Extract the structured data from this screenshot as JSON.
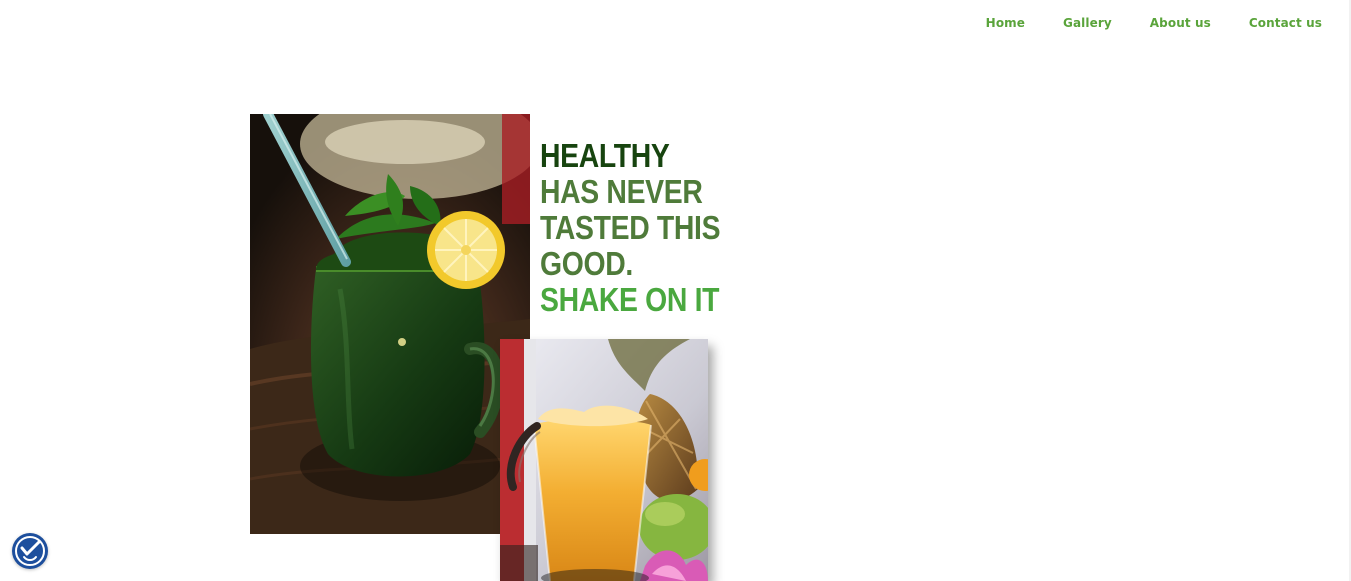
{
  "nav": {
    "items": [
      {
        "label": "Home"
      },
      {
        "label": "Gallery"
      },
      {
        "label": "About us"
      },
      {
        "label": "Contact us"
      }
    ]
  },
  "hero": {
    "headline_lines": [
      "HEALTHY",
      "HAS NEVER",
      "TASTED THIS",
      "GOOD.",
      "SHAKE ON IT"
    ],
    "images": {
      "main": "green-smoothie-photo",
      "secondary": "orange-juice-photo"
    }
  },
  "accessibility": {
    "icon": "accessibility-icon"
  },
  "colors": {
    "nav": "#5aa43b",
    "dark_green": "#17440f",
    "mid_green": "#4f7b3a",
    "bright_green": "#4aa83f",
    "badge_blue": "#1d4f9d"
  }
}
